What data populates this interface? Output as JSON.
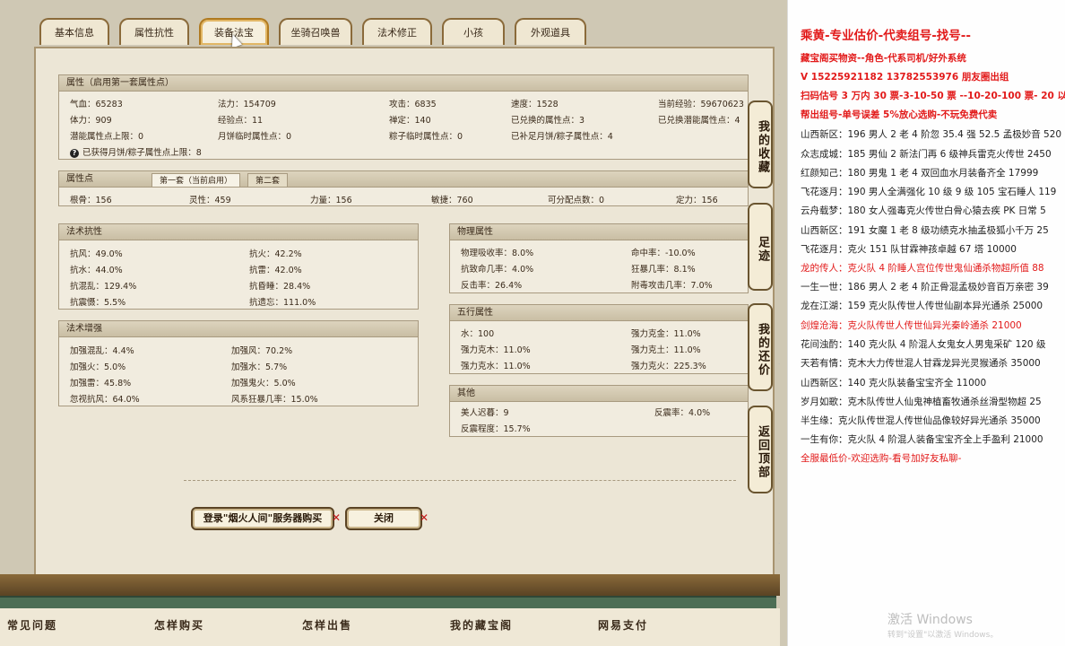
{
  "tabs": [
    "基本信息",
    "属性抗性",
    "装备法宝",
    "坐骑召唤兽",
    "法术修正",
    "小孩",
    "外观道具"
  ],
  "attrs": {
    "title": "属性（启用第一套属性点）",
    "rows": [
      [
        [
          "气血：",
          "65283"
        ],
        [
          "法力：",
          "154709"
        ],
        [
          "攻击：",
          "6835"
        ],
        [
          "速度：",
          "1528"
        ],
        [
          "当前经验：",
          "59670623"
        ]
      ],
      [
        [
          "体力：",
          "909"
        ],
        [
          "经验点：",
          "11"
        ],
        [
          "禅定：",
          "140"
        ],
        [
          "已兑换的属性点：",
          "3"
        ],
        [
          "已兑换潜能属性点：",
          "4"
        ]
      ],
      [
        [
          "潜能属性点上限：",
          "0"
        ],
        [
          "月饼临时属性点：",
          "0"
        ],
        [
          "粽子临时属性点：",
          "0"
        ],
        [
          "已补足月饼/粽子属性点：",
          "4"
        ],
        [
          "",
          ""
        ]
      ]
    ],
    "note": "已获得月饼/粽子属性点上限：8"
  },
  "points": {
    "title": "属性点",
    "tab1": "第一套（当前启用）",
    "tab2": "第二套",
    "row": [
      [
        "根骨：",
        "156"
      ],
      [
        "灵性：",
        "459"
      ],
      [
        "力量：",
        "156"
      ],
      [
        "敏捷：",
        "760"
      ],
      [
        "可分配点数：",
        "0"
      ],
      [
        "定力：",
        "156"
      ]
    ]
  },
  "resist": {
    "title": "法术抗性",
    "rows": [
      [
        [
          "抗风：",
          "49.0%"
        ],
        [
          "抗火：",
          "42.2%"
        ]
      ],
      [
        [
          "抗水：",
          "44.0%"
        ],
        [
          "抗雷：",
          "42.0%"
        ]
      ],
      [
        [
          "抗混乱：",
          "129.4%"
        ],
        [
          "抗昏睡：",
          "28.4%"
        ]
      ],
      [
        [
          "抗震慑：",
          "5.5%"
        ],
        [
          "抗遗忘：",
          "111.0%"
        ]
      ]
    ]
  },
  "boost": {
    "title": "法术增强",
    "rows": [
      [
        [
          "加强混乱：",
          "4.4%"
        ],
        [
          "加强风：",
          "70.2%"
        ]
      ],
      [
        [
          "加强火：",
          "5.0%"
        ],
        [
          "加强水：",
          "5.7%"
        ]
      ],
      [
        [
          "加强雷：",
          "45.8%"
        ],
        [
          "加强鬼火：",
          "5.0%"
        ]
      ],
      [
        [
          "忽视抗风：",
          "64.0%"
        ],
        [
          "风系狂暴几率：",
          "15.0%"
        ]
      ]
    ]
  },
  "physical": {
    "title": "物理属性",
    "rows": [
      [
        [
          "物理吸收率：",
          "8.0%"
        ],
        [
          "命中率：",
          "-10.0%"
        ]
      ],
      [
        [
          "抗致命几率：",
          "4.0%"
        ],
        [
          "狂暴几率：",
          "8.1%"
        ]
      ],
      [
        [
          "反击率：",
          "26.4%"
        ],
        [
          "附毒攻击几率：",
          "7.0%"
        ]
      ]
    ]
  },
  "five": {
    "title": "五行属性",
    "rows": [
      [
        [
          "水：",
          "100"
        ],
        [
          "强力克金：",
          "11.0%"
        ]
      ],
      [
        [
          "强力克木：",
          "11.0%"
        ],
        [
          "强力克土：",
          "11.0%"
        ]
      ],
      [
        [
          "强力克水：",
          "11.0%"
        ],
        [
          "强力克火：",
          "225.3%"
        ]
      ]
    ]
  },
  "other": {
    "title": "其他",
    "rows": [
      [
        [
          "美人迟暮：",
          "9"
        ],
        [
          "反震率：",
          "4.0%"
        ]
      ],
      [
        [
          "反震程度：",
          "15.7%"
        ],
        [
          "",
          ""
        ]
      ]
    ]
  },
  "buttons": {
    "login": "登录\"烟火人间\"服务器购买",
    "close": "关闭"
  },
  "side_buttons": [
    "我的收藏",
    "足迹",
    "我的还价",
    "返回顶部"
  ],
  "footer": [
    "常见问题",
    "怎样购买",
    "怎样出售",
    "我的藏宝阁",
    "网易支付"
  ],
  "right_lines": [
    "乘黄-专业估价-代卖组号-找号--",
    "藏宝阁买物资--角色-代系司机/好外系统",
    "V 15225921182   13782553976 朋友圈出组",
    "扫码估号 3 万内 30 票-3-10-50 票 --10-20-100 票- 20 以上",
    "帮出组号-单号误差 5%放心选购-不玩免费代卖",
    "山西新区：196 男人 2 老 4 阶忽 35.4 强 52.5 孟极妙音 520",
    "众志成城：185 男仙 2 新法门再 6 级神兵雷克火传世 2450",
    "红颜知己：180 男鬼 1 老 4 双回血水月装备齐全 17999",
    "飞花逐月：190 男人全满强化 10 级 9 级 105 宝石睡人 119",
    "云舟载梦：180 女人强毒克火传世白骨心猿去疾 PK 日常 5",
    "山西新区：191 女魔 1 老 8 级功绩克水抽孟极狐小千万 25",
    "飞花逐月：克火 151 队甘霖神孩卓越 67 塔 10000",
    "龙的传人：克火队 4 阶睡人宫位传世鬼仙通杀物超所值 88",
    "一生一世：186 男人 2 老 4 阶正骨混孟极妙音百万亲密 39",
    "龙在江湖：159 克火队传世人传世仙副本异光通杀 25000",
    "剑煌沧海：克火队传世人传世仙异光秦岭通杀 21000",
    "花间浊酌：140 克火队 4 阶混人女鬼女人男鬼采矿 120 级",
    "天若有情：克木大力传世混人甘霖龙异光灵猴通杀 35000",
    "山西新区：140 克火队装备宝宝齐全 11000",
    "岁月如歌：克木队传世人仙鬼神植畜牧通杀丝滑型物超 25",
    "半生缘：克火队传世混人传世仙品像较好异光通杀 35000",
    "一生有你：克火队 4 阶混人装备宝宝齐全上手盈利 21000",
    "全服最低价-欢迎选购-看号加好友私聊-"
  ],
  "watermark": [
    "激活 Windows",
    "转到\"设置\"以激活 Windows。"
  ]
}
